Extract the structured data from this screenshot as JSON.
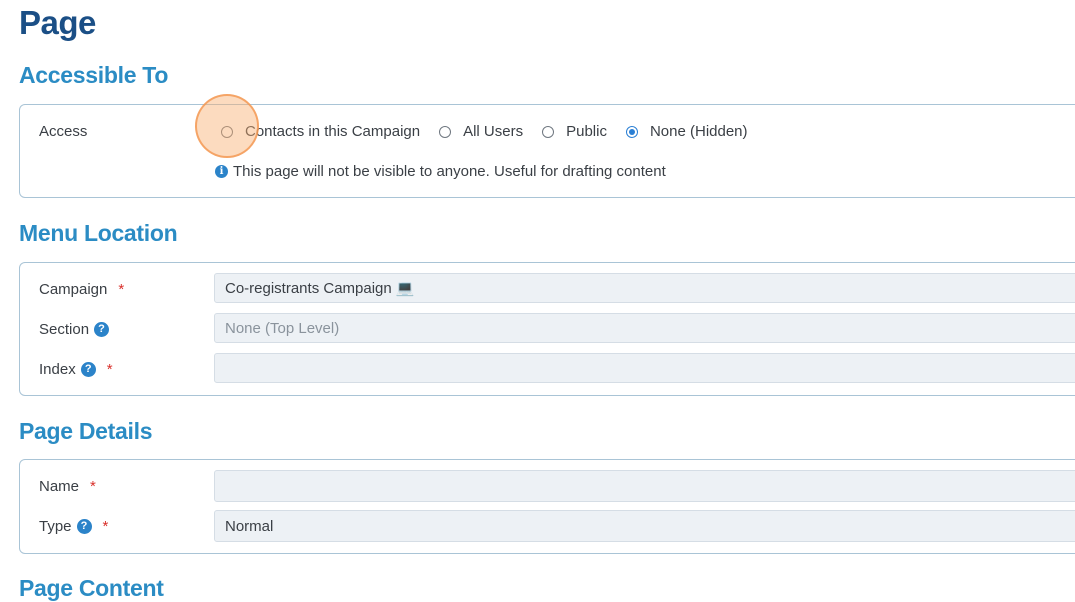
{
  "page": {
    "title": "Page"
  },
  "accessible_to": {
    "heading": "Accessible To",
    "access_label": "Access",
    "options": [
      {
        "label": "Contacts in this Campaign",
        "checked": false
      },
      {
        "label": "All Users",
        "checked": false
      },
      {
        "label": "Public",
        "checked": false
      },
      {
        "label": "None (Hidden)",
        "checked": true
      }
    ],
    "hint": "This page will not be visible to anyone. Useful for drafting content"
  },
  "menu_location": {
    "heading": "Menu Location",
    "campaign_label": "Campaign",
    "campaign_value": "Co-registrants Campaign 💻",
    "section_label": "Section",
    "section_placeholder": "None (Top Level)",
    "index_label": "Index",
    "index_value": ""
  },
  "page_details": {
    "heading": "Page Details",
    "name_label": "Name",
    "name_value": "",
    "type_label": "Type",
    "type_value": "Normal"
  },
  "page_content": {
    "heading": "Page Content"
  },
  "colors": {
    "title": "#1b4f86",
    "section": "#2b8cc4",
    "accent": "#2a7fd4",
    "required": "#d9302b"
  }
}
